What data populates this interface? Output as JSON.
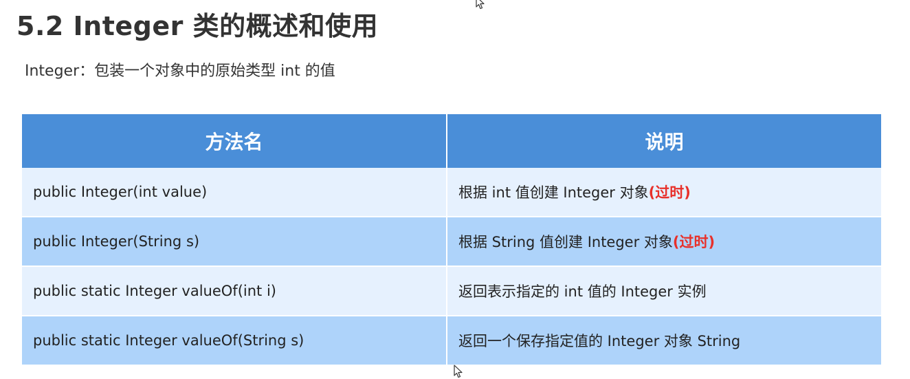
{
  "title": "5.2 Integer 类的概述和使用",
  "subtitle": "Integer：包装一个对象中的原始类型 int 的值",
  "table": {
    "headers": [
      "方法名",
      "说明"
    ],
    "rows": [
      {
        "method": "public Integer(int value)",
        "desc": "根据 int 值创建 Integer 对象",
        "note": "(过时)"
      },
      {
        "method": "public Integer(String s)",
        "desc": "根据 String 值创建 Integer 对象",
        "note": "(过时)"
      },
      {
        "method": "public static Integer valueOf(int i)",
        "desc": "返回表示指定的 int 值的 Integer 实例",
        "note": ""
      },
      {
        "method": "public static Integer valueOf(String s)",
        "desc": "返回一个保存指定值的 Integer 对象 String",
        "note": ""
      }
    ]
  },
  "colors": {
    "header": "#4a8ed8",
    "row_light": "#e6f1fe",
    "row_dark": "#aed3fa",
    "deprecated": "#e8302a"
  },
  "icons": [
    "mouse-cursor-icon"
  ]
}
